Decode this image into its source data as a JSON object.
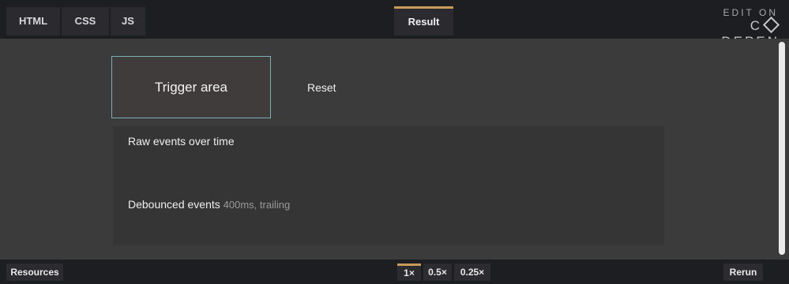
{
  "editor": {
    "tabs": [
      "HTML",
      "CSS",
      "JS"
    ],
    "result_tab": "Result",
    "brand_edit_on": "EDIT ON",
    "brand_codepen_left": "C",
    "brand_codepen_right": "DEPEN"
  },
  "preview": {
    "trigger_label": "Trigger area",
    "reset_label": "Reset",
    "raw_events_title": "Raw events over time",
    "debounced_title": "Debounced events",
    "debounced_meta": "400ms, trailing"
  },
  "footer": {
    "resources_label": "Resources",
    "zoom_options": [
      "1×",
      "0.5×",
      "0.25×"
    ],
    "active_zoom": "1×",
    "rerun_label": "Rerun"
  },
  "colors": {
    "active_tab_accent": "#c99a59",
    "trigger_border": "#7ab0b8"
  }
}
